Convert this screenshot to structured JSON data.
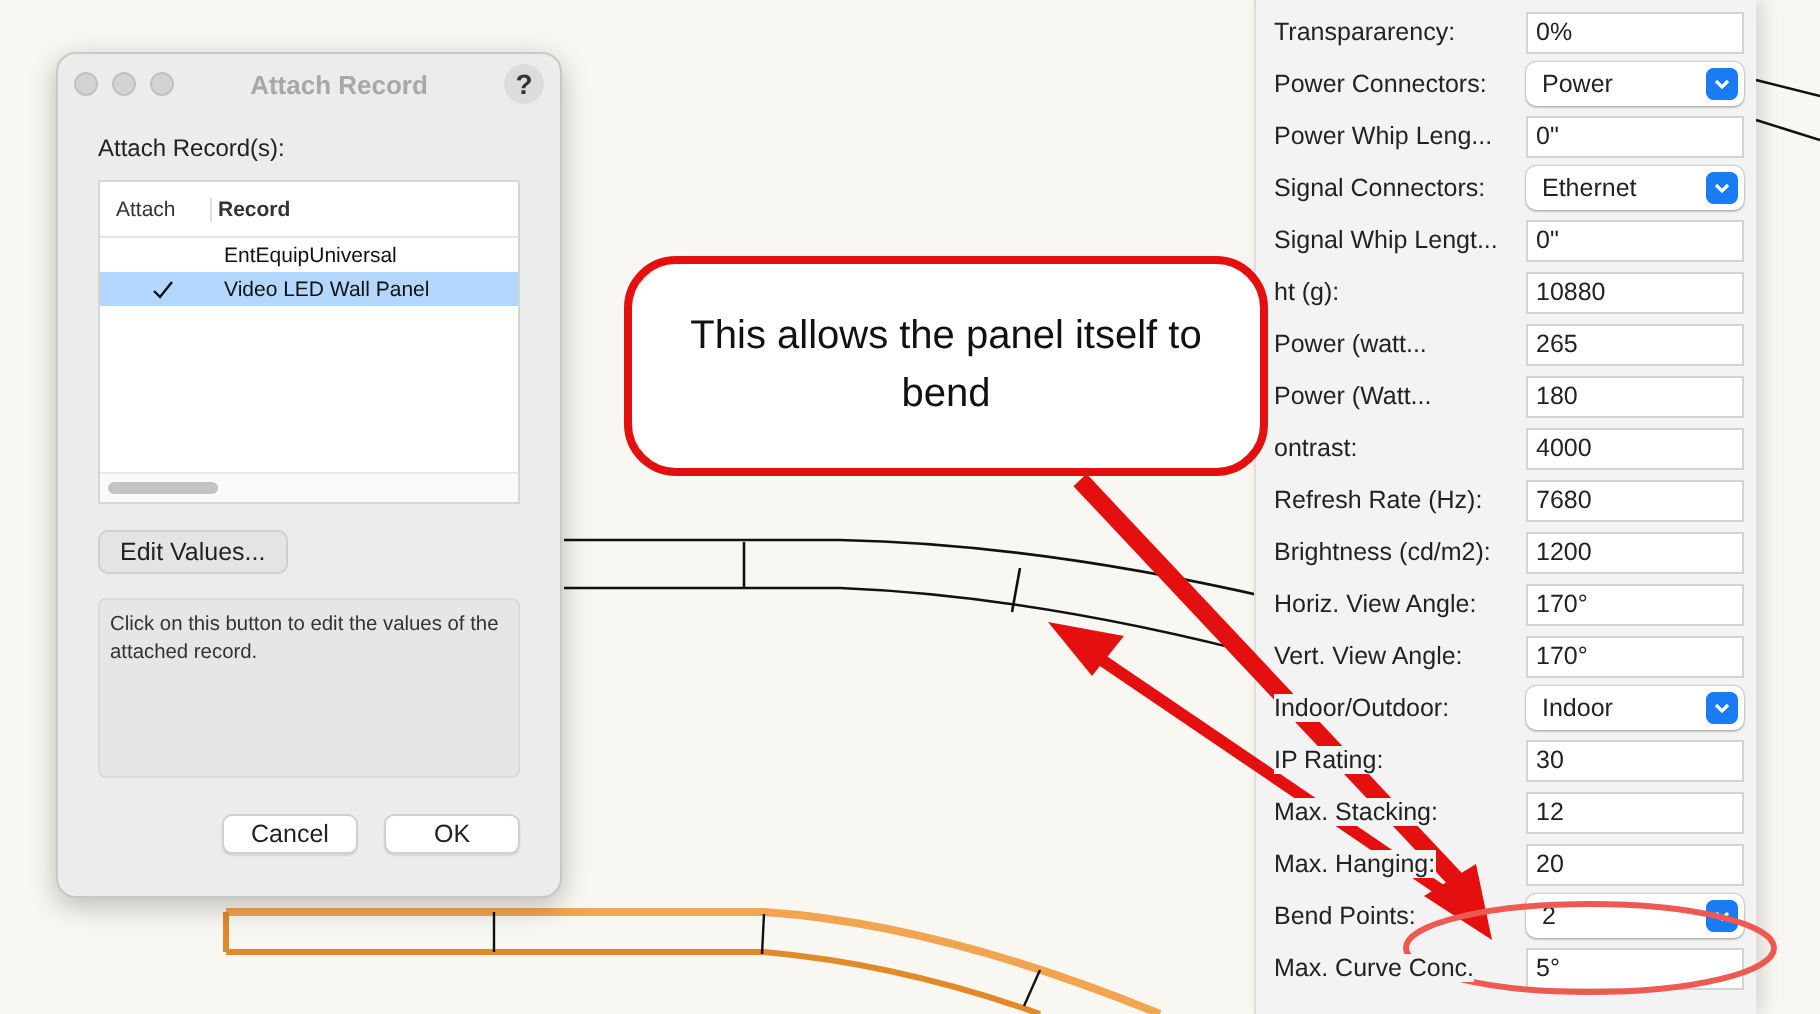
{
  "dialog": {
    "title": "Attach Record",
    "help": "?",
    "section_label": "Attach Record(s):",
    "columns": [
      "Attach",
      "Record"
    ],
    "rows": [
      {
        "attached": false,
        "record": "EntEquipUniversal",
        "selected": false
      },
      {
        "attached": true,
        "record": "Video LED Wall Panel",
        "selected": true
      }
    ],
    "edit_button": "Edit Values...",
    "description": "Click on this button to edit the values of the attached record.",
    "buttons": [
      "Cancel",
      "OK"
    ]
  },
  "properties": [
    {
      "label": "Transpararency:",
      "value": "0%",
      "kind": "text"
    },
    {
      "label": "Power Connectors:",
      "value": "Power",
      "kind": "dropdown"
    },
    {
      "label": "Power Whip Leng...",
      "value": "0\"",
      "kind": "text"
    },
    {
      "label": "Signal Connectors:",
      "value": "Ethernet",
      "kind": "dropdown"
    },
    {
      "label": "Signal Whip Lengt...",
      "value": "0\"",
      "kind": "text"
    },
    {
      "label": "ht (g):",
      "value": "10880",
      "kind": "text"
    },
    {
      "label": "Power (watt...",
      "value": "265",
      "kind": "text"
    },
    {
      "label": "Power (Watt...",
      "value": "180",
      "kind": "text"
    },
    {
      "label": "ontrast:",
      "value": "4000",
      "kind": "text"
    },
    {
      "label": "Refresh Rate (Hz):",
      "value": "7680",
      "kind": "text"
    },
    {
      "label": "Brightness (cd/m2):",
      "value": "1200",
      "kind": "text"
    },
    {
      "label": "Horiz. View Angle:",
      "value": "170°",
      "kind": "text"
    },
    {
      "label": "Vert. View Angle:",
      "value": "170°",
      "kind": "text"
    },
    {
      "label": "Indoor/Outdoor:",
      "value": "Indoor",
      "kind": "dropdown"
    },
    {
      "label": "IP Rating:",
      "value": "30",
      "kind": "text"
    },
    {
      "label": "Max. Stacking:",
      "value": "12",
      "kind": "text"
    },
    {
      "label": "Max. Hanging:",
      "value": "20",
      "kind": "text"
    },
    {
      "label": "Bend Points:",
      "value": "2",
      "kind": "dropdown"
    },
    {
      "label": "Max. Curve Conc.",
      "value": "5°",
      "kind": "text"
    }
  ],
  "callout": {
    "text": "This allows the panel itself to bend"
  }
}
